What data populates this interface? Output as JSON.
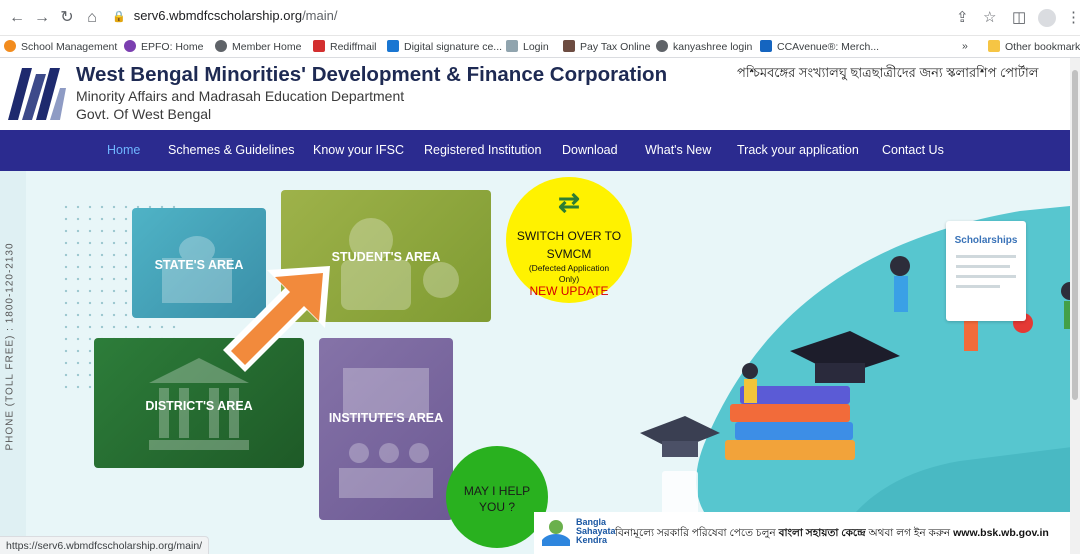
{
  "browser": {
    "url_host": "serv6.wbmdfcscholarship.org",
    "url_path": "/main/",
    "bookmarks": [
      {
        "label": "School Management",
        "color": "#f28c1e"
      },
      {
        "label": "EPFO: Home",
        "color": "#7b3fb0"
      },
      {
        "label": "Member Home",
        "color": "#5f6368"
      },
      {
        "label": "Rediffmail",
        "color": "#d32f2f"
      },
      {
        "label": "Digital signature ce...",
        "color": "#1976d2"
      },
      {
        "label": "Login",
        "color": "#90a4ae"
      },
      {
        "label": "Pay Tax Online",
        "color": "#6d4c41"
      },
      {
        "label": "kanyashree login",
        "color": "#5f6368"
      },
      {
        "label": "CCAvenue®: Merch...",
        "color": "#1565c0"
      }
    ],
    "overflow": "»",
    "other_bookmarks": "Other bookmarks",
    "status_url": "https://serv6.wbmdfcscholarship.org/main/"
  },
  "header": {
    "title": "West Bengal Minorities' Development & Finance Corporation",
    "subtitle": "Minority Affairs and Madrasah Education Department",
    "govt": "Govt. Of West Bengal",
    "bengali_title": "পশ্চিমবঙ্গের সংখ্যালঘু ছাত্রছাত্রীদের জন্য স্কলারশিপ পোর্টাল"
  },
  "nav": {
    "items": [
      {
        "label": "Home",
        "active": true
      },
      {
        "label": "Schemes & Guidelines"
      },
      {
        "label": "Know your IFSC"
      },
      {
        "label": "Registered Institution"
      },
      {
        "label": "Download"
      },
      {
        "label": "What's New"
      },
      {
        "label": "Track your application"
      },
      {
        "label": "Contact Us"
      }
    ]
  },
  "hero": {
    "phone": "PHONE (TOLL FREE) : 1800-120-2130",
    "tiles": {
      "state": "STATE'S AREA",
      "student": "STUDENT'S AREA",
      "district": "DISTRICT'S AREA",
      "institute": "INSTITUTE'S AREA"
    },
    "switch": {
      "line1": "SWITCH OVER TO",
      "line2": "SVMCM",
      "line3": "(Defected Application",
      "line4": "Only)",
      "line5": "NEW UPDATE"
    },
    "help": {
      "line1": "MAY I HELP",
      "line2": "YOU ?"
    },
    "scholarships_card": "Scholarships"
  },
  "bsk": {
    "name1": "Bangla",
    "name2": "Sahayata",
    "name3": "Kendra",
    "text_pre": "বিনামূল্যে সরকারি পরিষেবা পেতে চলুন ",
    "text_bold": "বাংলা সহায়তা কেন্দ্রে",
    "text_post": " অথবা লগ ইন করুন ",
    "site": "www.bsk.wb.gov.in"
  },
  "colors": {
    "nav_bg": "#2b2b8f",
    "nav_active": "#6fb6ff",
    "switch_bg": "#fff200",
    "help_bg": "#29b11f",
    "hero_bg": "#e8f6f8",
    "blob": "#57c6cf"
  }
}
